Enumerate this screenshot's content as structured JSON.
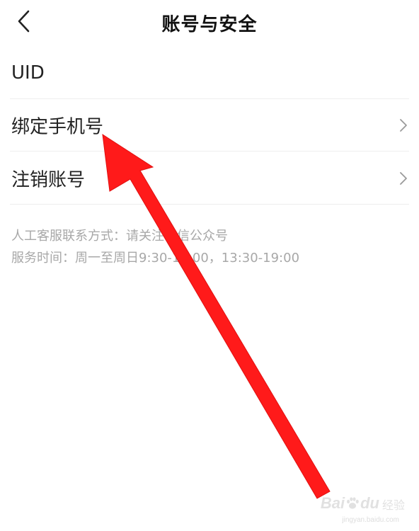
{
  "header": {
    "title": "账号与安全",
    "back_icon": "chevron-left-icon"
  },
  "list": {
    "items": [
      {
        "label": "UID",
        "has_chevron": false
      },
      {
        "label": "绑定手机号",
        "has_chevron": true
      },
      {
        "label": "注销账号",
        "has_chevron": true
      }
    ]
  },
  "service": {
    "contact_line": "人工客服联系方式：请关注微信公众号",
    "hours_line": "服务时间：周一至周日9:30-12:00，13:30-19:00"
  },
  "annotation": {
    "arrow_color": "#ff1a1a"
  },
  "watermark": {
    "brand": "Bai",
    "brand_suffix": "du",
    "sub": "经验",
    "url": "jingyan.baidu.com"
  }
}
